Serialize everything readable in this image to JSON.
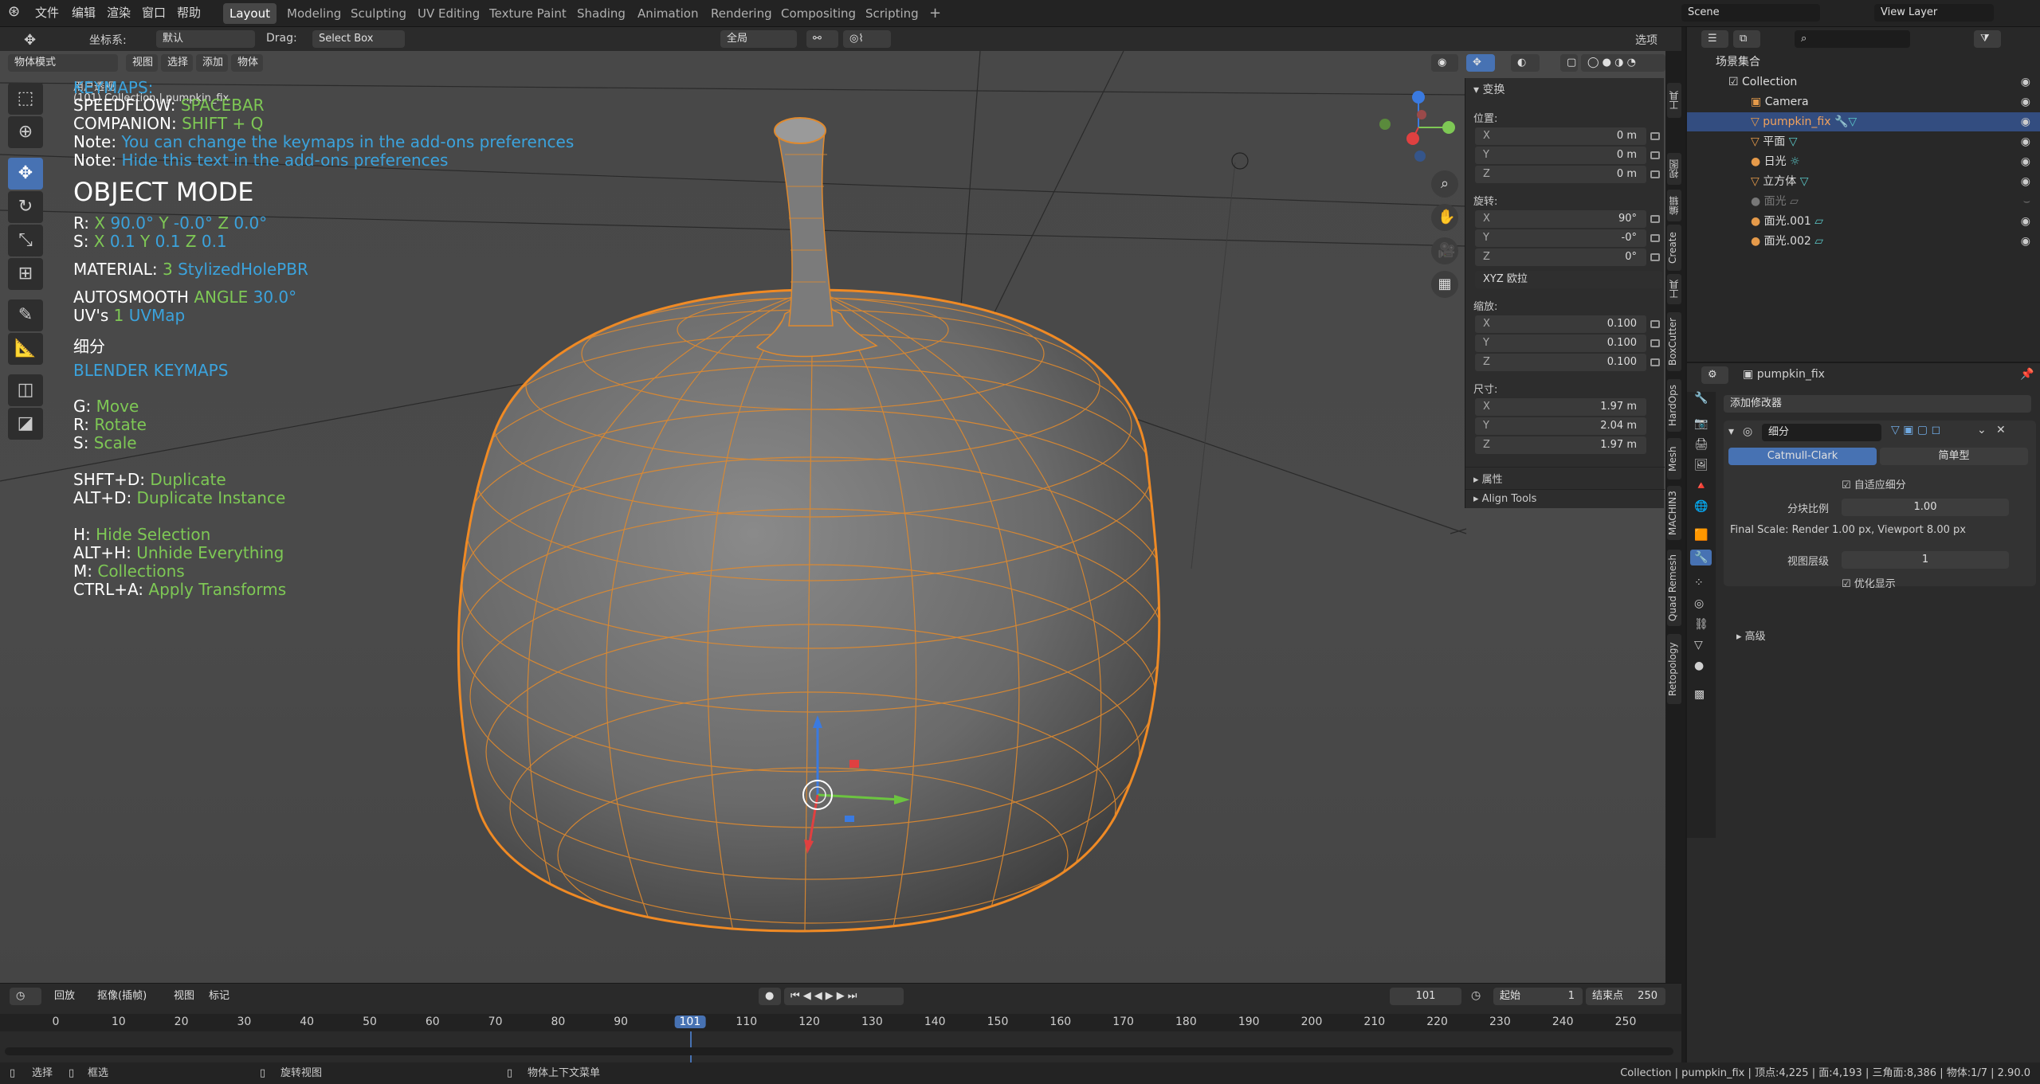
{
  "menubar": {
    "items": [
      "文件",
      "编辑",
      "渲染",
      "窗口",
      "帮助"
    ],
    "workspaces": [
      "Layout",
      "Modeling",
      "Sculpting",
      "UV Editing",
      "Texture Paint",
      "Shading",
      "Animation",
      "Rendering",
      "Compositing",
      "Scripting"
    ],
    "active_workspace": "Layout",
    "scene": "Scene",
    "view_layer": "View Layer"
  },
  "header": {
    "coord_label": "坐标系:",
    "coord_value": "默认",
    "drag_label": "Drag:",
    "drag_value": "Select Box",
    "pivot": "全局",
    "options": "选项",
    "mode": "物体模式",
    "view": "视图",
    "select": "选择",
    "add": "添加",
    "object": "物体"
  },
  "viewport": {
    "view_label": "用户透视",
    "collection_label": "(101) Collection | pumpkin_fix",
    "keymaps": "KEYMAPS:",
    "speedflow_k": "SPEEDFLOW:",
    "speedflow_v": "SPACEBAR",
    "companion_k": "COMPANION:",
    "companion_v": "SHIFT + Q",
    "note1_k": "Note:",
    "note1_v": "You can change the keymaps in the add-ons preferences",
    "note2_k": "Note:",
    "note2_v": "Hide this text in the add-ons preferences",
    "mode_title": "OBJECT MODE",
    "r_label": "R:",
    "r_x": "X",
    "r_xv": "90.0°",
    "r_y": "Y",
    "r_yv": "-0.0°",
    "r_z": "Z",
    "r_zv": "0.0°",
    "s_label": "S:",
    "s_x": "X",
    "s_xv": "0.1",
    "s_y": "Y",
    "s_yv": "0.1",
    "s_z": "Z",
    "s_zv": "0.1",
    "material_k": "MATERIAL:",
    "material_n": "3",
    "material_v": "StylizedHolePBR",
    "autosmooth_k": "AUTOSMOOTH",
    "angle_k": "ANGLE",
    "angle_v": "30.0°",
    "uv_k": "UV's",
    "uv_n": "1",
    "uv_v": "UVMap",
    "subdiv": "细分",
    "blender_keymaps": "BLENDER KEYMAPS",
    "g_k": "G:",
    "g_v": "Move",
    "r2_k": "R:",
    "r2_v": "Rotate",
    "s2_k": "S:",
    "s2_v": "Scale",
    "d_k": "SHFT+D:",
    "d_v": "Duplicate",
    "ad_k": "ALT+D:",
    "ad_v": "Duplicate Instance",
    "h_k": "H:",
    "h_v": "Hide Selection",
    "ah_k": "ALT+H:",
    "ah_v": "Unhide Everything",
    "m_k": "M:",
    "m_v": "Collections",
    "ca_k": "CTRL+A:",
    "ca_v": "Apply Transforms"
  },
  "npanel": {
    "transform": "变换",
    "location": "位置:",
    "loc": [
      "0 m",
      "0 m",
      "0 m"
    ],
    "rotation": "旋转:",
    "rot": [
      "90°",
      "-0°",
      "0°"
    ],
    "rot_mode": "XYZ 欧拉",
    "scale": "缩放:",
    "scl": [
      "0.100",
      "0.100",
      "0.100"
    ],
    "dimensions": "尺寸:",
    "dim": [
      "1.97 m",
      "2.04 m",
      "1.97 m"
    ],
    "axes": [
      "X",
      "Y",
      "Z"
    ],
    "properties": "属性",
    "align_tools": "Align Tools",
    "tabs": [
      "工具",
      "视图",
      "编辑",
      "Create",
      "工具",
      "BoxCutter",
      "HardOps",
      "Mesh",
      "MACHIN3",
      "Quad Remesh",
      "Retopology"
    ]
  },
  "outliner": {
    "scene_collection": "场景集合",
    "rows": [
      "Collection",
      "Camera",
      "pumpkin_fix",
      "平面",
      "日光",
      "立方体",
      "面光",
      "面光.001",
      "面光.002"
    ]
  },
  "properties": {
    "object": "pumpkin_fix",
    "add_modifier": "添加修改器",
    "mod_name": "细分",
    "catmull": "Catmull-Clark",
    "simple": "简单型",
    "adaptive": "自适应细分",
    "ratio_label": "分块比例",
    "ratio_value": "1.00",
    "final_scale": "Final Scale: Render 1.00 px, Viewport 8.00 px",
    "levels_label": "视图层级",
    "levels_value": "1",
    "optimal": "优化显示",
    "advanced": "高级"
  },
  "timeline": {
    "playback": "回放",
    "keying": "抠像(插帧)",
    "view": "视图",
    "marker": "标记",
    "current_frame": "101",
    "start_label": "起始",
    "start": "1",
    "end_label": "结束点",
    "end": "250",
    "ticks": [
      "0",
      "10",
      "20",
      "30",
      "40",
      "50",
      "60",
      "70",
      "80",
      "90",
      "101",
      "110",
      "120",
      "130",
      "140",
      "150",
      "160",
      "170",
      "180",
      "190",
      "200",
      "210",
      "220",
      "230",
      "240",
      "250"
    ]
  },
  "status": {
    "select": "选择",
    "box": "框选",
    "rotate": "旋转视图",
    "context": "物体上下文菜单",
    "info": "Collection | pumpkin_fix | 顶点:4,225 | 面:4,193 | 三角面:8,386 | 物体:1/7 | 2.90.0"
  }
}
